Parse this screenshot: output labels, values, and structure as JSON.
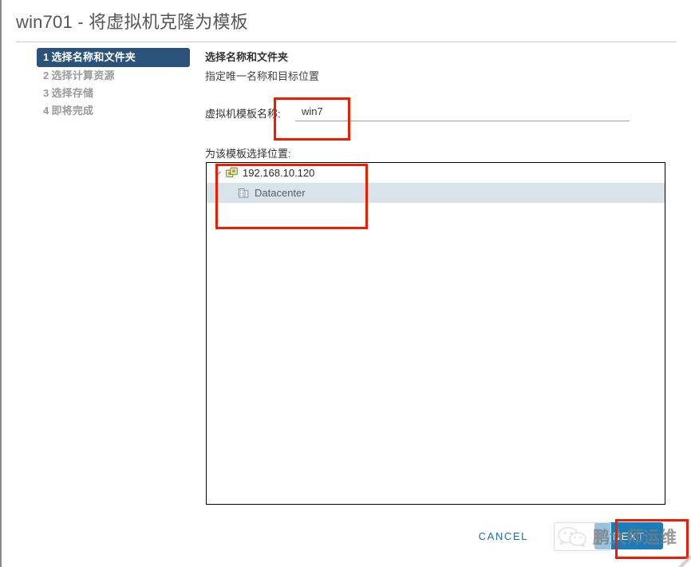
{
  "window": {
    "title": "win701 - 将虚拟机克隆为模板"
  },
  "steps": [
    {
      "num": "1",
      "label": "选择名称和文件夹",
      "active": true
    },
    {
      "num": "2",
      "label": "选择计算资源",
      "active": false
    },
    {
      "num": "3",
      "label": "选择存储",
      "active": false
    },
    {
      "num": "4",
      "label": "即将完成",
      "active": false
    }
  ],
  "panel": {
    "heading": "选择名称和文件夹",
    "subheading": "指定唯一名称和目标位置"
  },
  "name_field": {
    "label": "虚拟机模板名称:",
    "value": "win7",
    "placeholder": ""
  },
  "tree_section": {
    "label": "为该模板选择位置:",
    "rows": [
      {
        "level": 0,
        "label": "192.168.10.120",
        "icon": "host-icon",
        "toggle": "chevron-down-icon",
        "selected": false
      },
      {
        "level": 1,
        "label": "Datacenter",
        "icon": "datacenter-icon",
        "toggle": "none",
        "selected": true
      }
    ]
  },
  "footer": {
    "cancel_label": "CANCEL",
    "next_label": "NEXT"
  },
  "watermark": {
    "text": "鹏大师运维",
    "logo": "wechat-icon"
  },
  "colors": {
    "active_step_bg": "#2b5279",
    "primary_button": "#1b7cbb",
    "link_blue": "#1c6ea4",
    "selection_row": "#d9e4ea",
    "annotation_red": "#f01c00"
  }
}
